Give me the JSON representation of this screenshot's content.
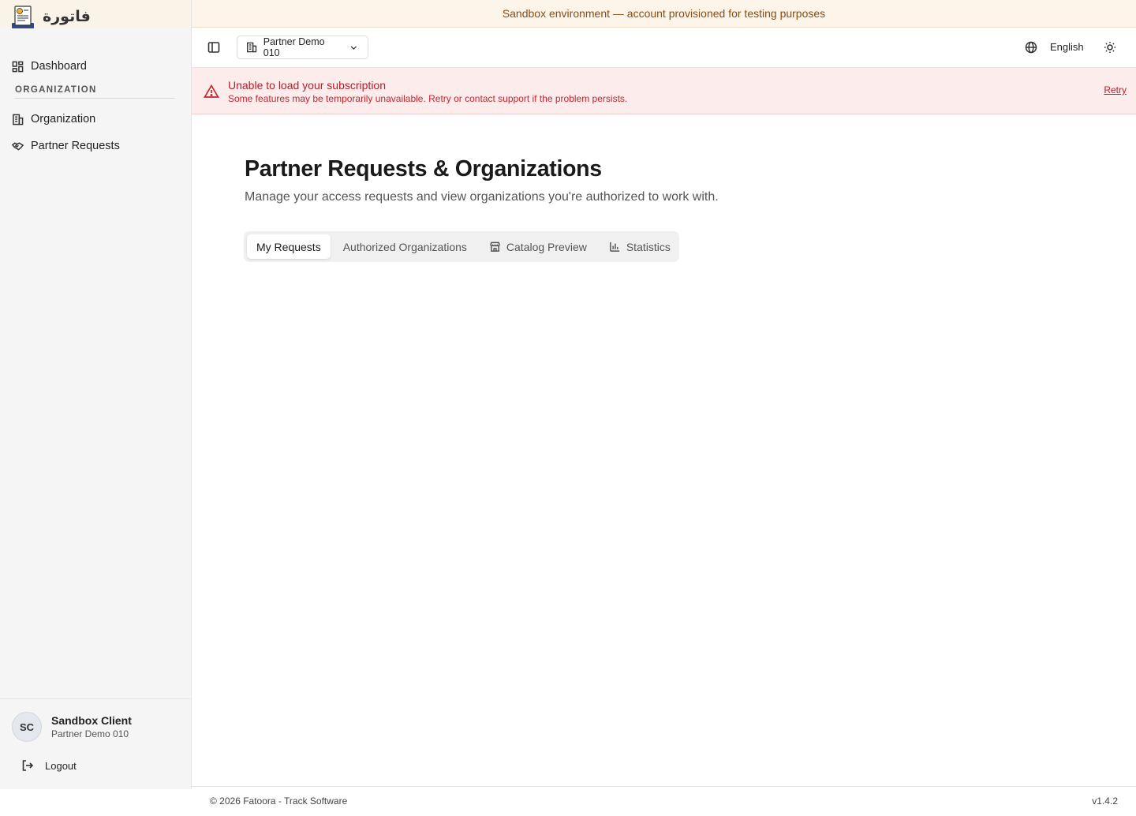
{
  "brand": {
    "logo_text": "فاتورة"
  },
  "sandbox_banner": {
    "text": "Sandbox environment — account provisioned for testing purposes"
  },
  "sidebar": {
    "dashboard_label": "Dashboard",
    "section_label": "ORGANIZATION",
    "items": [
      {
        "label": "Organization",
        "icon": "building-icon"
      },
      {
        "label": "Partner Requests",
        "icon": "handshake-icon"
      }
    ],
    "user": {
      "initials": "SC",
      "name": "Sandbox Client",
      "org": "Partner Demo 010"
    },
    "logout_label": "Logout"
  },
  "header": {
    "org_selector": "Partner Demo 010",
    "language": "English"
  },
  "error_banner": {
    "title": "Unable to load your subscription",
    "description": "Some features may be temporarily unavailable. Retry or contact support if the problem persists.",
    "retry_label": "Retry"
  },
  "main": {
    "title": "Partner Requests & Organizations",
    "subtitle": "Manage your access requests and view organizations you're authorized to work with.",
    "tabs": [
      {
        "label": "My Requests",
        "active": true
      },
      {
        "label": "Authorized Organizations",
        "active": false
      },
      {
        "label": "Catalog Preview",
        "active": false,
        "icon": "store-icon"
      },
      {
        "label": "Statistics",
        "active": false,
        "icon": "bar-chart-icon"
      }
    ]
  },
  "footer": {
    "copyright": "© 2026 Fatoora - Track Software",
    "version": "v1.4.2"
  },
  "colors": {
    "sandbox_banner_bg": "#fdf5e9",
    "sandbox_banner_text": "#8a4b10",
    "error_bg": "#fdecec",
    "error_text": "#b3202a"
  }
}
